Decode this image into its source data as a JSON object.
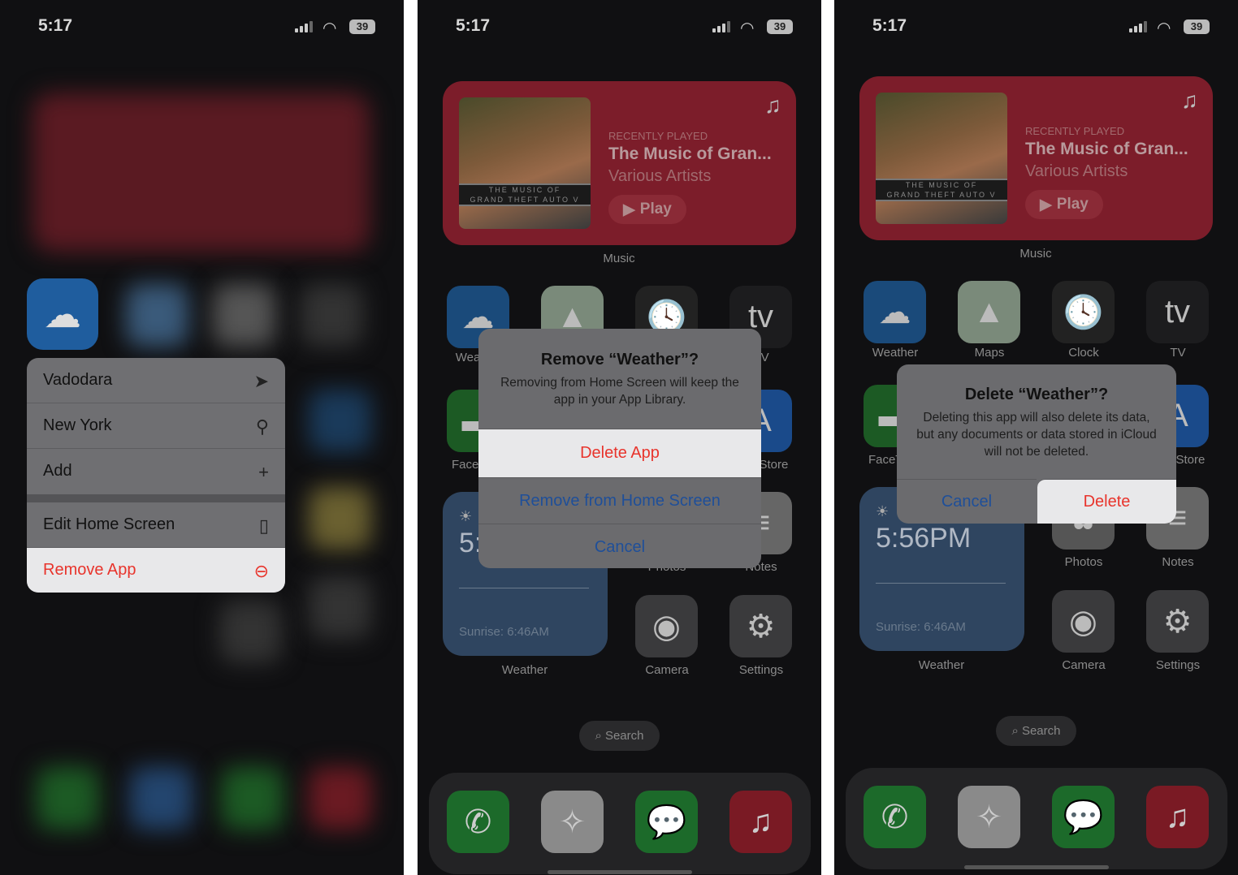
{
  "status": {
    "time": "5:17",
    "battery": "39"
  },
  "panel1": {
    "menu": [
      {
        "label": "Vadodara",
        "icon": "location-arrow-icon",
        "glyph": "➤"
      },
      {
        "label": "New York",
        "icon": "location-pin-icon",
        "glyph": "⚲"
      },
      {
        "label": "Add",
        "icon": "plus-icon",
        "glyph": "+"
      },
      {
        "label": "Edit Home Screen",
        "icon": "phone-icon",
        "glyph": "▯"
      },
      {
        "label": "Remove App",
        "icon": "minus-circle-icon",
        "glyph": "⊖"
      }
    ]
  },
  "music_widget": {
    "header": "RECENTLY PLAYED",
    "title": "The Music of Gran...",
    "artist": "Various Artists",
    "play": "Play",
    "album_line1": "THE MUSIC OF",
    "album_line2": "GRAND THEFT AUTO V",
    "label": "Music"
  },
  "apps": {
    "weather": "Weather",
    "maps": "Maps",
    "clock": "Clock",
    "tv": "TV",
    "facetime": "FaceTime",
    "appstore": "App Store",
    "photos": "Photos",
    "notes": "Notes",
    "camera": "Camera",
    "settings": "Settings"
  },
  "weather_widget": {
    "time": "5:56PM",
    "sunrise": "Sunrise: 6:46AM",
    "label": "Weather"
  },
  "search": "Search",
  "panel2": {
    "dialog": {
      "title": "Remove “Weather”?",
      "message": "Removing from Home Screen will keep the app in your App Library.",
      "buttons": [
        "Delete App",
        "Remove from Home Screen",
        "Cancel"
      ]
    }
  },
  "panel3": {
    "dialog": {
      "title": "Delete “Weather”?",
      "message": "Deleting this app will also delete its data, but any documents or data stored in iCloud will not be deleted.",
      "cancel": "Cancel",
      "delete": "Delete"
    }
  },
  "colors": {
    "destructive": "#e8342c",
    "action": "#1f4f99",
    "music": "#7c1d2a"
  }
}
